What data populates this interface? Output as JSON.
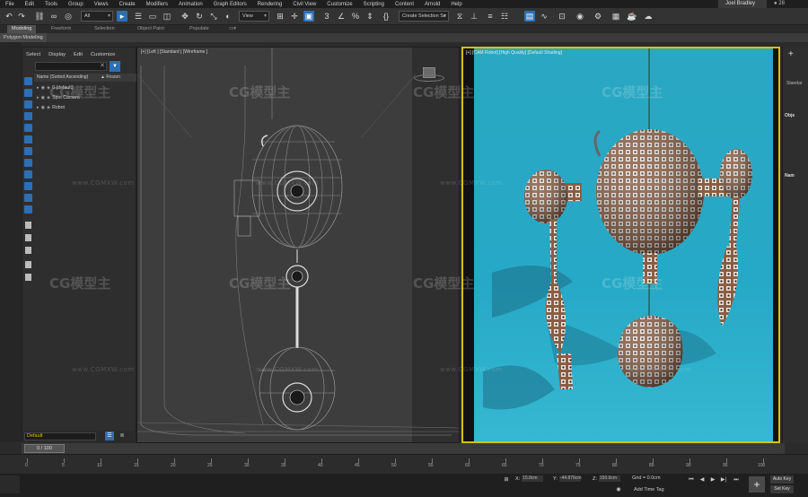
{
  "menu": [
    "File",
    "Edit",
    "Tools",
    "Group",
    "Views",
    "Create",
    "Modifiers",
    "Animation",
    "Graph Editors",
    "Rendering",
    "Civil View",
    "Customize",
    "Scripting",
    "Content",
    "Arnold",
    "Help"
  ],
  "user": {
    "name": "Joel Bradley",
    "badge": "28"
  },
  "toolbar": {
    "selection_filter": "All",
    "ref_coord": "View",
    "named_selection": "Create Selection Se"
  },
  "ribbon": {
    "tabs": [
      "Modeling",
      "Freeform",
      "Selection",
      "Object Paint",
      "Populate"
    ],
    "active_tab": "Modeling",
    "panel_label": "Polygon Modeling"
  },
  "explorer": {
    "menu": [
      "Select",
      "Display",
      "Edit",
      "Customize"
    ],
    "col_name": "Name (Sorted Ascending)",
    "col_frozen": "▲ Frozen",
    "rows": [
      {
        "label": "0 (default)"
      },
      {
        "label": "Spot Camera"
      },
      {
        "label": "Robot"
      }
    ],
    "layer": "Default"
  },
  "viewport_left": {
    "label": "[+] [Left ] [Standard ] [Wireframe ]"
  },
  "viewport_right": {
    "label": "[+] [CAM Robot] [High Quality] [Default Shading]"
  },
  "command_panel": {
    "std": "Standar",
    "obj": "Obje",
    "name": "Nam"
  },
  "watermark": {
    "logo": "CG模型主",
    "url": "www.CGMXW.com"
  },
  "timeline": {
    "frame_display": "0 / 100",
    "ticks": [
      "0",
      "5",
      "10",
      "15",
      "20",
      "25",
      "30",
      "35",
      "40",
      "45",
      "50",
      "55",
      "60",
      "65",
      "70",
      "75",
      "80",
      "85",
      "90",
      "95",
      "100"
    ]
  },
  "status": {
    "x_label": "X:",
    "x_val": "15.8cm",
    "y_label": "Y:",
    "y_val": "-44.876cm",
    "z_label": "Z:",
    "z_val": "150.0cm",
    "grid": "Grid = 0.0cm",
    "add_time_tag": "Add Time Tag",
    "auto_key": "Auto Key",
    "set_key": "Set Key"
  },
  "colors": {
    "accent": "#2d6fb5",
    "viewport_highlight": "#d6c200",
    "render_background": "#27a8c4"
  }
}
